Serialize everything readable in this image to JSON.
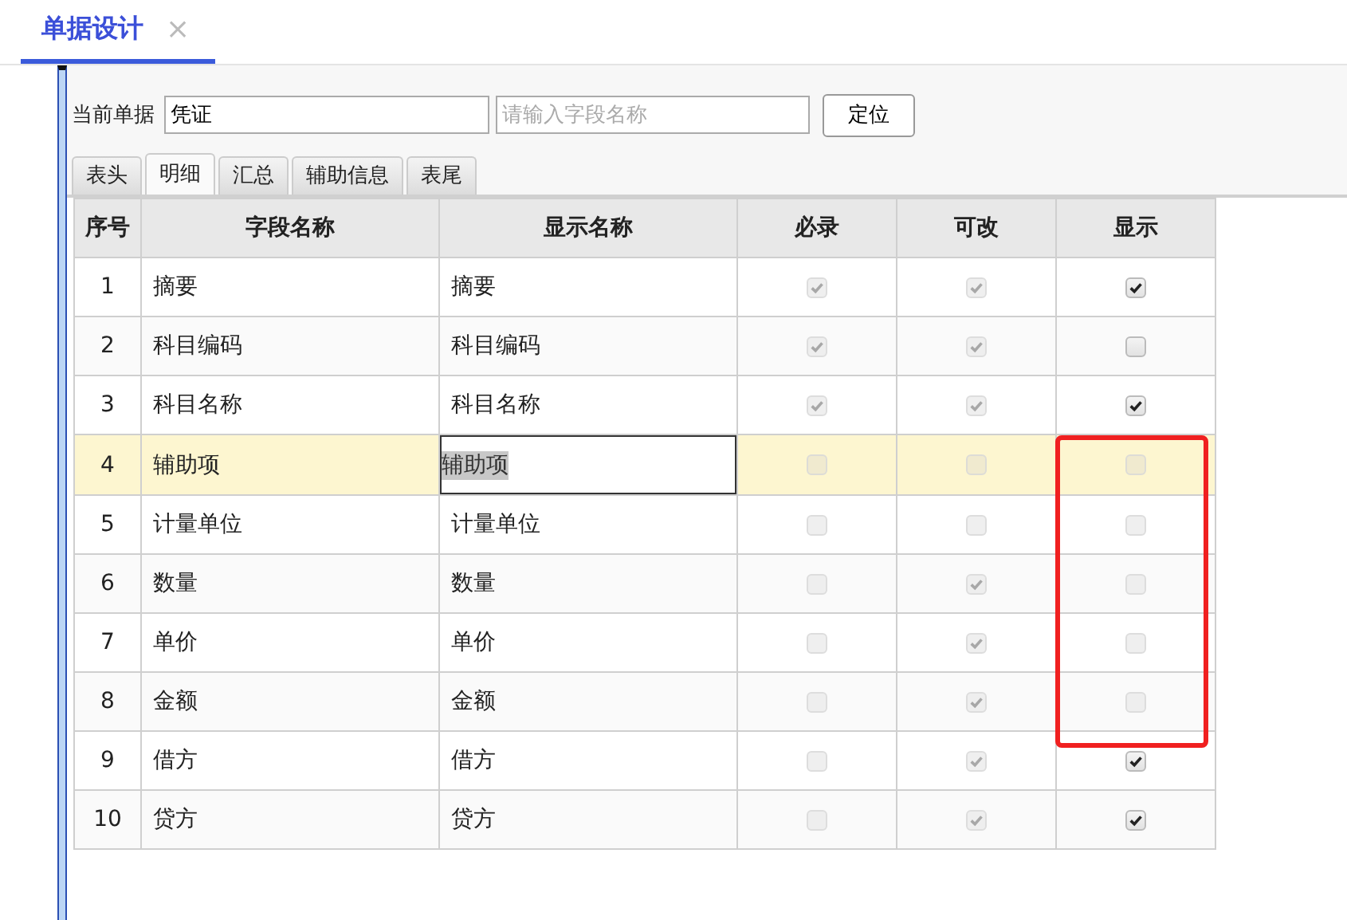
{
  "page_tab": {
    "title": "单据设计",
    "close": "×"
  },
  "toolbar": {
    "label": "当前单据",
    "document": "凭证",
    "search": {
      "placeholder": "请输入字段名称"
    },
    "button": "定位"
  },
  "tabs": [
    {
      "label": "表头",
      "selected": false
    },
    {
      "label": "明细",
      "selected": true
    },
    {
      "label": "汇总",
      "selected": false
    },
    {
      "label": "辅助信息",
      "selected": false
    },
    {
      "label": "表尾",
      "selected": false
    }
  ],
  "table": {
    "columns": [
      "序号",
      "字段名称",
      "显示名称",
      "必录",
      "可改",
      "显示"
    ],
    "rows": [
      {
        "no": "1",
        "field": "摘要",
        "display": "摘要",
        "selected": false,
        "editing": false,
        "marked": false,
        "required": {
          "checked": true,
          "disabled": true
        },
        "editable": {
          "checked": true,
          "disabled": true
        },
        "show": {
          "checked": true,
          "disabled": false
        }
      },
      {
        "no": "2",
        "field": "科目编码",
        "display": "科目编码",
        "selected": false,
        "editing": false,
        "marked": false,
        "required": {
          "checked": true,
          "disabled": true
        },
        "editable": {
          "checked": true,
          "disabled": true
        },
        "show": {
          "checked": false,
          "disabled": false
        }
      },
      {
        "no": "3",
        "field": "科目名称",
        "display": "科目名称",
        "selected": false,
        "editing": false,
        "marked": false,
        "required": {
          "checked": true,
          "disabled": true
        },
        "editable": {
          "checked": true,
          "disabled": true
        },
        "show": {
          "checked": true,
          "disabled": false
        }
      },
      {
        "no": "4",
        "field": "辅助项",
        "display": "辅助项",
        "selected": true,
        "editing": true,
        "marked": true,
        "required": {
          "checked": false,
          "disabled": true
        },
        "editable": {
          "checked": false,
          "disabled": true
        },
        "show": {
          "checked": false,
          "disabled": true
        }
      },
      {
        "no": "5",
        "field": "计量单位",
        "display": "计量单位",
        "selected": false,
        "editing": false,
        "marked": true,
        "required": {
          "checked": false,
          "disabled": true
        },
        "editable": {
          "checked": false,
          "disabled": true
        },
        "show": {
          "checked": false,
          "disabled": true
        }
      },
      {
        "no": "6",
        "field": "数量",
        "display": "数量",
        "selected": false,
        "editing": false,
        "marked": true,
        "required": {
          "checked": false,
          "disabled": true
        },
        "editable": {
          "checked": true,
          "disabled": true
        },
        "show": {
          "checked": false,
          "disabled": true
        }
      },
      {
        "no": "7",
        "field": "单价",
        "display": "单价",
        "selected": false,
        "editing": false,
        "marked": true,
        "required": {
          "checked": false,
          "disabled": true
        },
        "editable": {
          "checked": true,
          "disabled": true
        },
        "show": {
          "checked": false,
          "disabled": true
        }
      },
      {
        "no": "8",
        "field": "金额",
        "display": "金额",
        "selected": false,
        "editing": false,
        "marked": true,
        "required": {
          "checked": false,
          "disabled": true
        },
        "editable": {
          "checked": true,
          "disabled": true
        },
        "show": {
          "checked": false,
          "disabled": true
        }
      },
      {
        "no": "9",
        "field": "借方",
        "display": "借方",
        "selected": false,
        "editing": false,
        "marked": false,
        "required": {
          "checked": false,
          "disabled": true
        },
        "editable": {
          "checked": true,
          "disabled": true
        },
        "show": {
          "checked": true,
          "disabled": false
        }
      },
      {
        "no": "10",
        "field": "贷方",
        "display": "贷方",
        "selected": false,
        "editing": false,
        "marked": false,
        "required": {
          "checked": false,
          "disabled": true
        },
        "editable": {
          "checked": true,
          "disabled": true
        },
        "show": {
          "checked": true,
          "disabled": false
        }
      }
    ]
  }
}
